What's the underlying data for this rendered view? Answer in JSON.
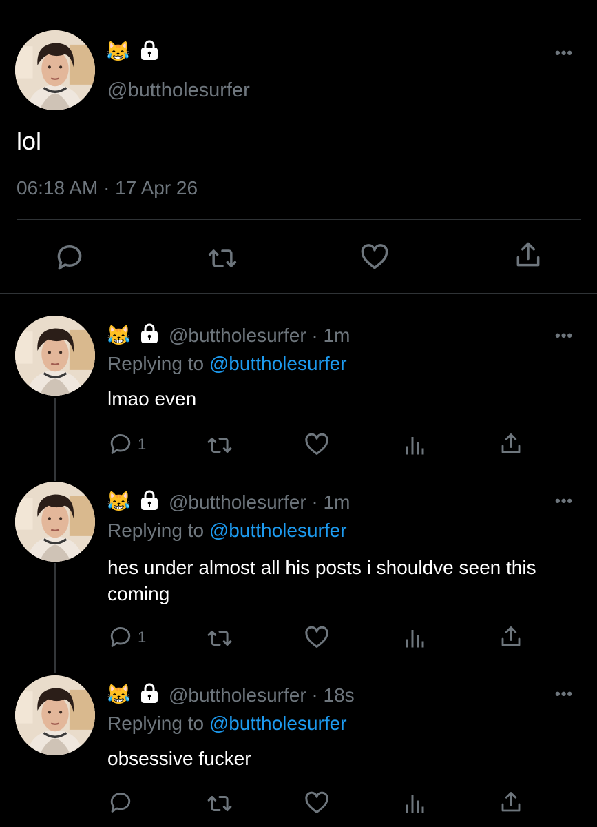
{
  "main_post": {
    "emoji": "😹",
    "handle": "@buttholesurfer",
    "text": "lol",
    "timestamp": "06:18 AM · 17 Apr 26"
  },
  "replies": [
    {
      "emoji": "😹",
      "handle": "@buttholesurfer",
      "time": "· 1m",
      "replying_label": "Replying to",
      "replying_to": "@buttholesurfer",
      "text": "lmao even",
      "reply_count": "1"
    },
    {
      "emoji": "😹",
      "handle": "@buttholesurfer",
      "time": "· 1m",
      "replying_label": "Replying to",
      "replying_to": "@buttholesurfer",
      "text": "hes under almost all his posts i shouldve seen this coming",
      "reply_count": "1"
    },
    {
      "emoji": "😹",
      "handle": "@buttholesurfer",
      "time": "· 18s",
      "replying_label": "Replying to",
      "replying_to": "@buttholesurfer",
      "text": "obsessive fucker",
      "reply_count": ""
    }
  ],
  "colors": {
    "background": "#000000",
    "muted": "#6e767d",
    "accent": "#1d9bf0",
    "divider": "#2f3336"
  },
  "icons": [
    "reply-icon",
    "retweet-icon",
    "like-icon",
    "share-icon",
    "analytics-icon",
    "lock-icon",
    "more-icon"
  ]
}
